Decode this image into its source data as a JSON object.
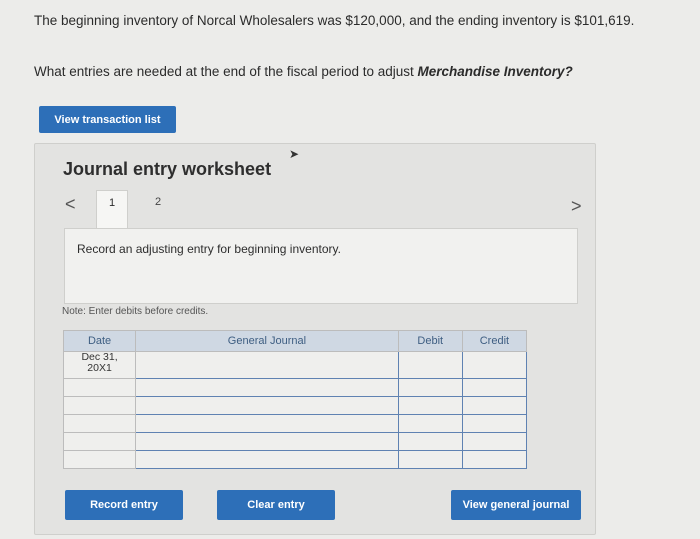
{
  "question": {
    "line1": "The beginning inventory of Norcal Wholesalers was $120,000, and the ending inventory is $101,619.",
    "line2_prefix": "What entries are needed at the end of the fiscal period to adjust ",
    "line2_emphasis": "Merchandise Inventory?"
  },
  "buttons": {
    "view_transactions": "View transaction list",
    "record_entry": "Record entry",
    "clear_entry": "Clear entry",
    "view_journal": "View general journal"
  },
  "worksheet": {
    "title": "Journal entry worksheet",
    "prev": "<",
    "next": ">",
    "tabs": [
      "1",
      "2"
    ],
    "instruction": "Record an adjusting entry for beginning inventory.",
    "note": "Note: Enter debits before credits."
  },
  "table": {
    "headers": {
      "date": "Date",
      "journal": "General Journal",
      "debit": "Debit",
      "credit": "Credit"
    },
    "date_line1": "Dec 31,",
    "date_line2": "20X1"
  },
  "colors": {
    "accent": "#2d6fb8",
    "header_bg": "#cfd8e3",
    "input_border": "#5f82b2"
  }
}
